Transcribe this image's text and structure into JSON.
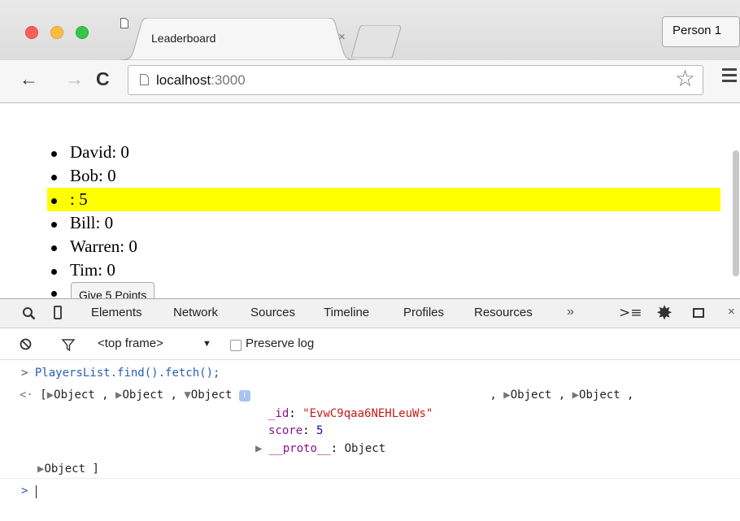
{
  "browser": {
    "tab_title": "Leaderboard",
    "tab_close": "×",
    "person_button": "Person 1",
    "url_host": "localhost",
    "url_port": ":3000",
    "back_icon": "←",
    "forward_icon": "→",
    "reload_icon": "C",
    "star_icon": "☆"
  },
  "page": {
    "players": [
      {
        "text": "David: 0",
        "selected": false
      },
      {
        "text": "Bob: 0",
        "selected": false
      },
      {
        "text": ": 5",
        "selected": true
      },
      {
        "text": "Bill: 0",
        "selected": false
      },
      {
        "text": "Warren: 0",
        "selected": false
      },
      {
        "text": "Tim: 0",
        "selected": false
      }
    ],
    "give_button": "Give 5 Points",
    "highlight_color": "#ffff00"
  },
  "devtools": {
    "tabs": [
      "Elements",
      "Network",
      "Sources",
      "Timeline",
      "Profiles",
      "Resources"
    ],
    "more": "»",
    "frame_selector": "<top frame>",
    "frame_caret": "▼",
    "preserve_log": "Preserve log",
    "console": {
      "input_prompt": ">",
      "input_command": "PlayersList.find().fetch();",
      "output_marker": "<·",
      "array_open": "[",
      "array_close": "]",
      "object_label": "Object",
      "comma": " ,",
      "expanded": {
        "badge": "i",
        "id_key": "_id",
        "id_value": "\"EvwC9qaa6NEHLeuWs\"",
        "score_key": "score",
        "score_value": "5",
        "proto_key": "__proto__",
        "proto_value": "Object"
      },
      "cursor_prompt": ">"
    }
  }
}
